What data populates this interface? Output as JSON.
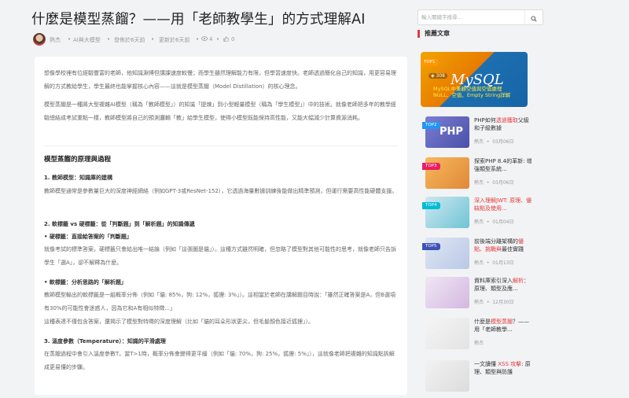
{
  "article": {
    "title": "什麼是模型蒸餾？——用「老師教學生」的方式理解AI",
    "author": "熱杰",
    "category": "AI與大模型",
    "published": "發佈於6天前",
    "updated": "更新於6天前",
    "views": "4",
    "likes": "0",
    "intro_1": "想像學校裡有位經驗豐富的老師，他知識淵博但講課速度較慢；而學生雖然理解能力有限，但學習速度快。老師透過簡化自己的知識，用更容易理解的方式教給學生，學生最終也能掌握核心內容——這就是模型蒸餾（Model Distillation）的核心理念。",
    "intro_2": "模型蒸餾是一種將大型複雜AI模型（稱為「教師模型」）的知識「提煉」到小型輕量模型（稱為「學生模型」）中的技術。就像老師把多年的教學經驗總結成考試重點一樣，教師模型將自己的預測邏輯「教」給學生模型，使得小模型既能保持高性能，又能大幅減少計算資源消耗。",
    "section_title": "模型蒸餾的原理與過程",
    "s1_title": "1. 教師模型：知識庫的建構",
    "s1_text": "教師模型通常是參數量巨大的深度神經網絡（例如GPT-3或ResNet-152），它透過海量數據訓練後能做出精準預測，但運行需要高性能硬體支援。",
    "s2_title": "2. 軟標籤 vs 硬標籤：從「判斷題」到「解析題」的知識傳遞",
    "s2_hard_title": "• 硬標籤：直接給答案的「判斷題」",
    "s2_hard_text": "就像考試的標準答案，硬標籤只會給出唯一結論（例如「這張圖是貓」）。這種方式雖然明確，但忽略了模型對其他可能性的思考，就像老師只告訴學生「選A」，卻不解釋為什麼。",
    "s2_soft_title": "• 軟標籤：分析思路的「解析題」",
    "s2_soft_text1": "教師模型輸出的軟標籤是一組概率分佈（例如「貓: 85%，狗: 12%，狐狸: 3%」）。這相當於老師在講解題目時說：「雖然正確答案是A，但B選項有30%的可能性會迷惑人，因為它和A有相似特徵...」",
    "s2_soft_text2": "這種表達不僅包含答案，還揭示了模型對特徵的深度理解（比如「貓的耳朵形狀更尖，但毛髮顏色接近狐狸」）。",
    "s3_title": "3. 溫度參數（Temperature）：知識的平滑處理",
    "s3_text": "在蒸餾過程中會引入溫度參數T。當T>1時，概率分佈會變得更平緩（例如「貓: 70%，狗: 25%，狐狸: 5%」），這就像老師把複雜的知識點拆解成更易懂的步驟。"
  },
  "sidebar": {
    "search_placeholder": "輸入關鍵字搜尋...",
    "heading": "推薦文章",
    "hero": {
      "tag": "TOP1",
      "views": "308",
      "logo_text": "MySQL",
      "caption": "MySQL中兼顧空值與空值處理 NULL、空值、Empty String詳解"
    },
    "items": [
      {
        "tag": "TOP2",
        "t1": "PHP如何",
        "hl": "透過獲取",
        "t2": "父級和子級數據",
        "author": "熱杰",
        "date": "03月06日",
        "thumb_text": "PHP"
      },
      {
        "tag": "TOP3",
        "t1": "探索PHP 8.4的革新: 增強類型系統...",
        "hl": "",
        "t2": "",
        "author": "熱杰",
        "date": "03月06日",
        "thumb_text": ""
      },
      {
        "tag": "TOP4",
        "t1": "",
        "hl": "深入理解JWT: 原理、優缺點及使用...",
        "t2": "",
        "author": "熱杰",
        "date": "01月04日",
        "thumb_text": ""
      },
      {
        "tag": "TOP5",
        "t1": "前後端分離架構的",
        "hl": "優點、挑戰與",
        "t2": "最佳實踐",
        "author": "熱杰",
        "date": "01月13日",
        "thumb_text": ""
      },
      {
        "tag": "",
        "t1": "資料庫索引深入",
        "hl": "解析",
        "t2": "：原理、類型及應...",
        "author": "熱杰",
        "date": "12月30日",
        "thumb_text": ""
      },
      {
        "tag": "",
        "t1": "什麼是",
        "hl": "模型蒸餾",
        "t2": "？——用「老師教學...",
        "author": "熱杰",
        "date": "",
        "thumb_text": ""
      },
      {
        "tag": "",
        "t1": "一文讀懂 ",
        "hl": "XSS 攻擊",
        "t2": ": 原理、類型與防護",
        "author": "",
        "date": "",
        "thumb_text": ""
      }
    ]
  },
  "colors": {
    "accent": "#e4393c",
    "top1": "#ff9800",
    "top2": "#2196f3",
    "top3": "#e91e63",
    "top4": "#00bcd4",
    "top5": "#3f51b5"
  }
}
